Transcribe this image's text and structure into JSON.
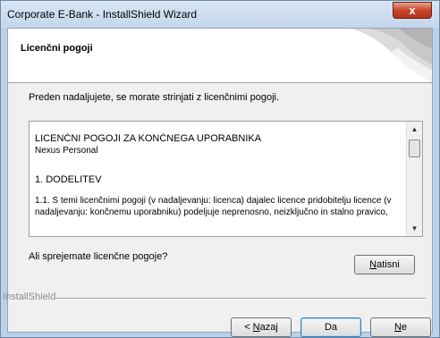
{
  "window": {
    "title": "Corporate E-Bank - InstallShield Wizard",
    "close_glyph": "x"
  },
  "header": {
    "title": "Licenčni pogoji"
  },
  "instruction": "Preden nadaljujete, se morate strinjati z licenčnimi pogoji.",
  "license": {
    "heading": "LICENČNI POGOJI ZA KONČNEGA UPORABNIKA",
    "product": "Nexus Personal",
    "section": "1. DODELITEV",
    "line1": "1.1. S temi licenčnimi pogoji (v nadaljevanju: licenca) dajalec licence pridobitelju licence (v",
    "line2": "nadaljevanju: končnemu uporabniku) podeljuje neprenosno, neizključno in stalno pravico,"
  },
  "question": "Ali sprejemate licenčne pogoje?",
  "buttons": {
    "print": {
      "label": "Natisni",
      "mnemonic": "N",
      "rest": "atisni"
    },
    "back": {
      "prefix": "< ",
      "mnemonic": "N",
      "rest": "azaj"
    },
    "yes": {
      "label": "Da"
    },
    "no": {
      "mnemonic": "N",
      "rest": "e"
    }
  },
  "footer": {
    "brand": "InstallShield"
  }
}
